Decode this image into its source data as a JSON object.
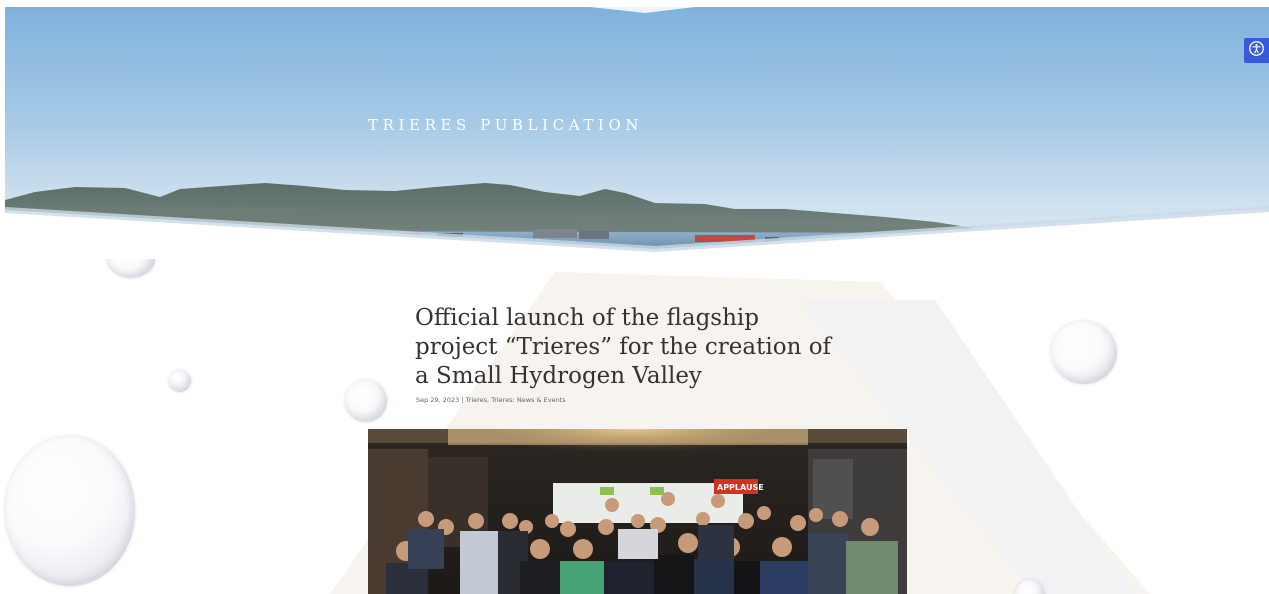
{
  "hero": {
    "title": "TRIERES PUBLICATION"
  },
  "accessibility": {
    "icon": "accessibility-icon",
    "color": "#3a5bd9"
  },
  "article": {
    "title": "Official launch of the flagship project “Trieres” for the creation of a Small Hydrogen Valley",
    "meta": {
      "date": "Sep 29, 2023",
      "separator": "|",
      "category_1": "Trieres",
      "category_sep": ", ",
      "category_2": "Trieres: News & Events"
    },
    "photo": {
      "sign_text": "APPLAUSE"
    }
  },
  "colors": {
    "accent": "#3a5bd9",
    "title_text": "#333333",
    "meta_text": "#666666"
  }
}
